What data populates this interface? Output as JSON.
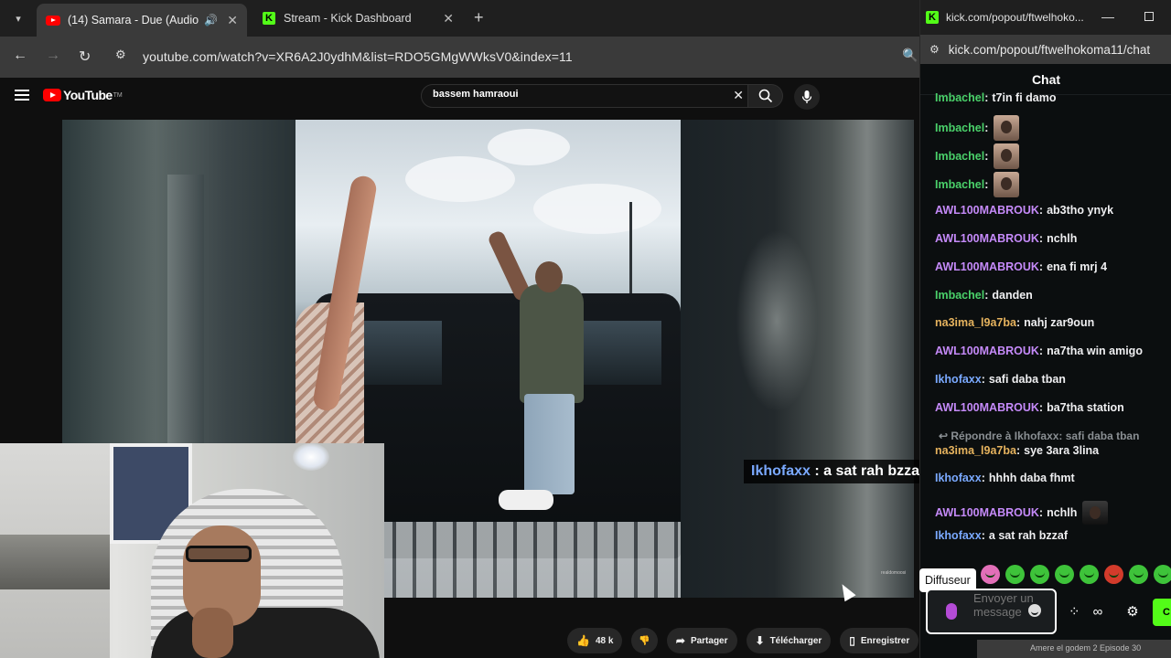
{
  "browser": {
    "tabs": [
      {
        "title": "(14) Samara - Due (Audio) (",
        "active": true
      },
      {
        "title": "Stream - Kick Dashboard",
        "active": false
      }
    ],
    "url": "youtube.com/watch?v=XR6A2J0ydhM&list=RDO5GMgWWksV0&index=11"
  },
  "youtube": {
    "logo_text": "YouTube",
    "logo_tm": "TM",
    "search_value": "bassem hamraoui",
    "watermark": "realdomoosi",
    "overlay": {
      "user": "Ikhofaxx",
      "sep": " : ",
      "text": "a sat rah bzzaf"
    },
    "actions": {
      "likes": "48 k",
      "share": "Partager",
      "download": "Télécharger",
      "save": "Enregistrer"
    }
  },
  "kick": {
    "window_title": "kick.com/popout/ftwelhoko...",
    "url": "kick.com/popout/ftwelhokoma11/chat",
    "chat_title": "Chat",
    "colors": {
      "green": "#4ad16a",
      "purple": "#c58af9",
      "blue": "#7aa9ff",
      "orange": "#e6b35e",
      "brand": "#53fc18"
    },
    "messages": [
      {
        "user": "Imbachel",
        "text": "t7in fi damo",
        "color": "#4ad16a",
        "emote": false
      },
      {
        "user": "Imbachel",
        "text": "",
        "color": "#4ad16a",
        "emote": true
      },
      {
        "user": "Imbachel",
        "text": "",
        "color": "#4ad16a",
        "emote": true
      },
      {
        "user": "Imbachel",
        "text": "",
        "color": "#4ad16a",
        "emote": true
      },
      {
        "user": "AWL100MABROUK",
        "text": "ab3tho ynyk",
        "color": "#c58af9",
        "emote": false
      },
      {
        "user": "AWL100MABROUK",
        "text": "nchlh",
        "color": "#c58af9",
        "emote": false
      },
      {
        "user": "AWL100MABROUK",
        "text": "ena fi mrj 4",
        "color": "#c58af9",
        "emote": false
      },
      {
        "user": "Imbachel",
        "text": "danden",
        "color": "#4ad16a",
        "emote": false
      },
      {
        "user": "na3ima_l9a7ba",
        "text": "nahj zar9oun",
        "color": "#e6b35e",
        "emote": false
      },
      {
        "user": "AWL100MABROUK",
        "text": "na7tha win amigo",
        "color": "#c58af9",
        "emote": false
      },
      {
        "user": "Ikhofaxx",
        "text": "safi daba tban",
        "color": "#7aa9ff",
        "emote": false
      },
      {
        "user": "AWL100MABROUK",
        "text": "ba7tha station",
        "color": "#c58af9",
        "emote": false
      },
      {
        "user": "na3ima_l9a7ba",
        "text": "sye 3ara 3lina",
        "color": "#e6b35e",
        "emote": false
      },
      {
        "user": "Ikhofaxx",
        "text": "hhhh daba fhmt",
        "color": "#7aa9ff",
        "emote": false
      },
      {
        "user": "AWL100MABROUK",
        "text": "nchlh",
        "color": "#c58af9",
        "emote": true
      },
      {
        "user": "Ikhofaxx",
        "text": "a sat rah bzzaf",
        "color": "#7aa9ff",
        "emote": false
      }
    ],
    "reply_note": "Répondre à Ikhofaxx: safi daba tban",
    "tooltip": "Diffuseur",
    "input_placeholder": "Envoyer un message",
    "bottom_text": "Amere el godem 2 Episode 30"
  }
}
